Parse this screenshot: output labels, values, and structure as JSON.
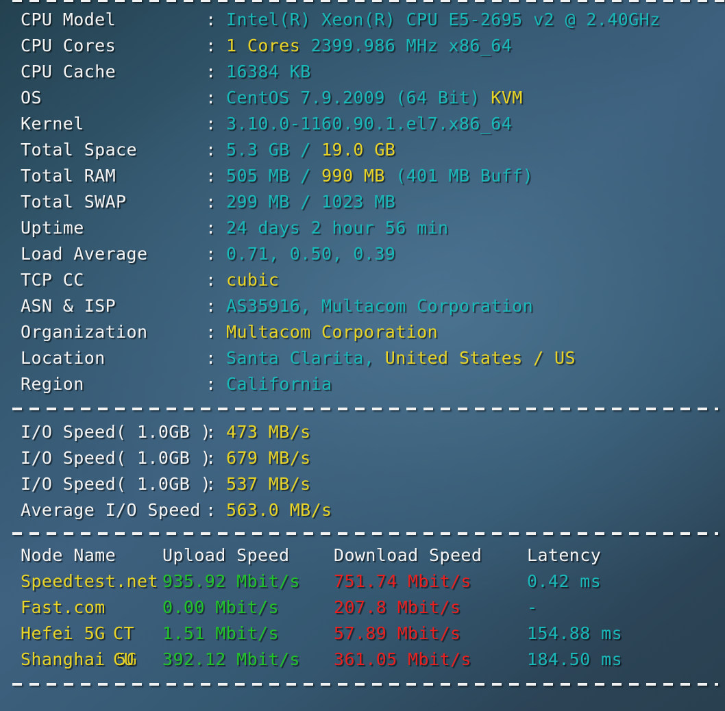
{
  "colors": {
    "background_dark": "#23414f",
    "background_light": "#3e6280",
    "label": "#f4f4f4",
    "cyan": "#1ab8b8",
    "yellow": "#e8d428",
    "green": "#22c32a",
    "red": "#e82020"
  },
  "separators": {
    "char": "-",
    "top": "---------------------------------------------------------------",
    "middle": "---------------------------------------------------------------",
    "lower": "---------------------------------------------------------------",
    "bottom": "---------------------------------------------------------------"
  },
  "system_info": {
    "colon": ":",
    "rows": [
      {
        "label": "CPU Model",
        "value_cyan": "Intel(R) Xeon(R) CPU E5-2695 v2 @ 2.40GHz",
        "value_yellow": "",
        "value_tail": ""
      },
      {
        "label": "CPU Cores",
        "value_cyan": "",
        "value_yellow": "1 Cores",
        "value_tail": " 2399.986 MHz x86_64"
      },
      {
        "label": "CPU Cache",
        "value_cyan": "16384 KB",
        "value_yellow": "",
        "value_tail": ""
      },
      {
        "label": "OS",
        "value_cyan": "CentOS 7.9.2009 (64 Bit) ",
        "value_yellow": "KVM",
        "value_tail": ""
      },
      {
        "label": "Kernel",
        "value_cyan": "3.10.0-1160.90.1.el7.x86_64",
        "value_yellow": "",
        "value_tail": ""
      },
      {
        "label": "Total Space",
        "value_cyan": "5.3 GB / ",
        "value_yellow": "19.0 GB",
        "value_tail": ""
      },
      {
        "label": "Total RAM",
        "value_cyan": "505 MB / ",
        "value_yellow": "990 MB",
        "value_tail": " (401 MB Buff)"
      },
      {
        "label": "Total SWAP",
        "value_cyan": "299 MB / 1023 MB",
        "value_yellow": "",
        "value_tail": ""
      },
      {
        "label": "Uptime",
        "value_cyan": "24 days 2 hour 56 min",
        "value_yellow": "",
        "value_tail": ""
      },
      {
        "label": "Load Average",
        "value_cyan": "0.71, 0.50, 0.39",
        "value_yellow": "",
        "value_tail": ""
      },
      {
        "label": "TCP CC",
        "value_cyan": "",
        "value_yellow": "cubic",
        "value_tail": ""
      },
      {
        "label": "ASN & ISP",
        "value_cyan": "AS35916, Multacom Corporation",
        "value_yellow": "",
        "value_tail": ""
      },
      {
        "label": "Organization",
        "value_cyan": "",
        "value_yellow": "Multacom Corporation",
        "value_tail": ""
      },
      {
        "label": "Location",
        "value_cyan": "Santa Clarita, ",
        "value_yellow": "United States / US",
        "value_tail": ""
      },
      {
        "label": "Region",
        "value_cyan": "California",
        "value_yellow": "",
        "value_tail": ""
      }
    ]
  },
  "io_speed": {
    "colon": ":",
    "rows": [
      {
        "label": "I/O Speed( 1.0GB )",
        "value": "473 MB/s"
      },
      {
        "label": "I/O Speed( 1.0GB )",
        "value": "679 MB/s"
      },
      {
        "label": "I/O Speed( 1.0GB )",
        "value": "537 MB/s"
      },
      {
        "label": "Average I/O Speed",
        "value": "563.0 MB/s"
      }
    ]
  },
  "speedtest": {
    "headers": {
      "node": "Node Name",
      "isp": "",
      "upload": "Upload Speed",
      "download": "Download Speed",
      "latency": "Latency"
    },
    "rows": [
      {
        "node": "Speedtest.net",
        "isp": "",
        "upload": "935.92 Mbit/s",
        "download": "751.74 Mbit/s",
        "latency": "0.42 ms"
      },
      {
        "node": "Fast.com",
        "isp": "",
        "upload": "0.00 Mbit/s",
        "download": "207.8 Mbit/s",
        "latency": "-"
      },
      {
        "node": "Hefei 5G",
        "isp": "CT",
        "upload": "1.51 Mbit/s",
        "download": "57.89 Mbit/s",
        "latency": "154.88 ms"
      },
      {
        "node": "Shanghai 5G",
        "isp": "CU",
        "upload": "392.12 Mbit/s",
        "download": "361.05 Mbit/s",
        "latency": "184.50 ms"
      }
    ]
  }
}
